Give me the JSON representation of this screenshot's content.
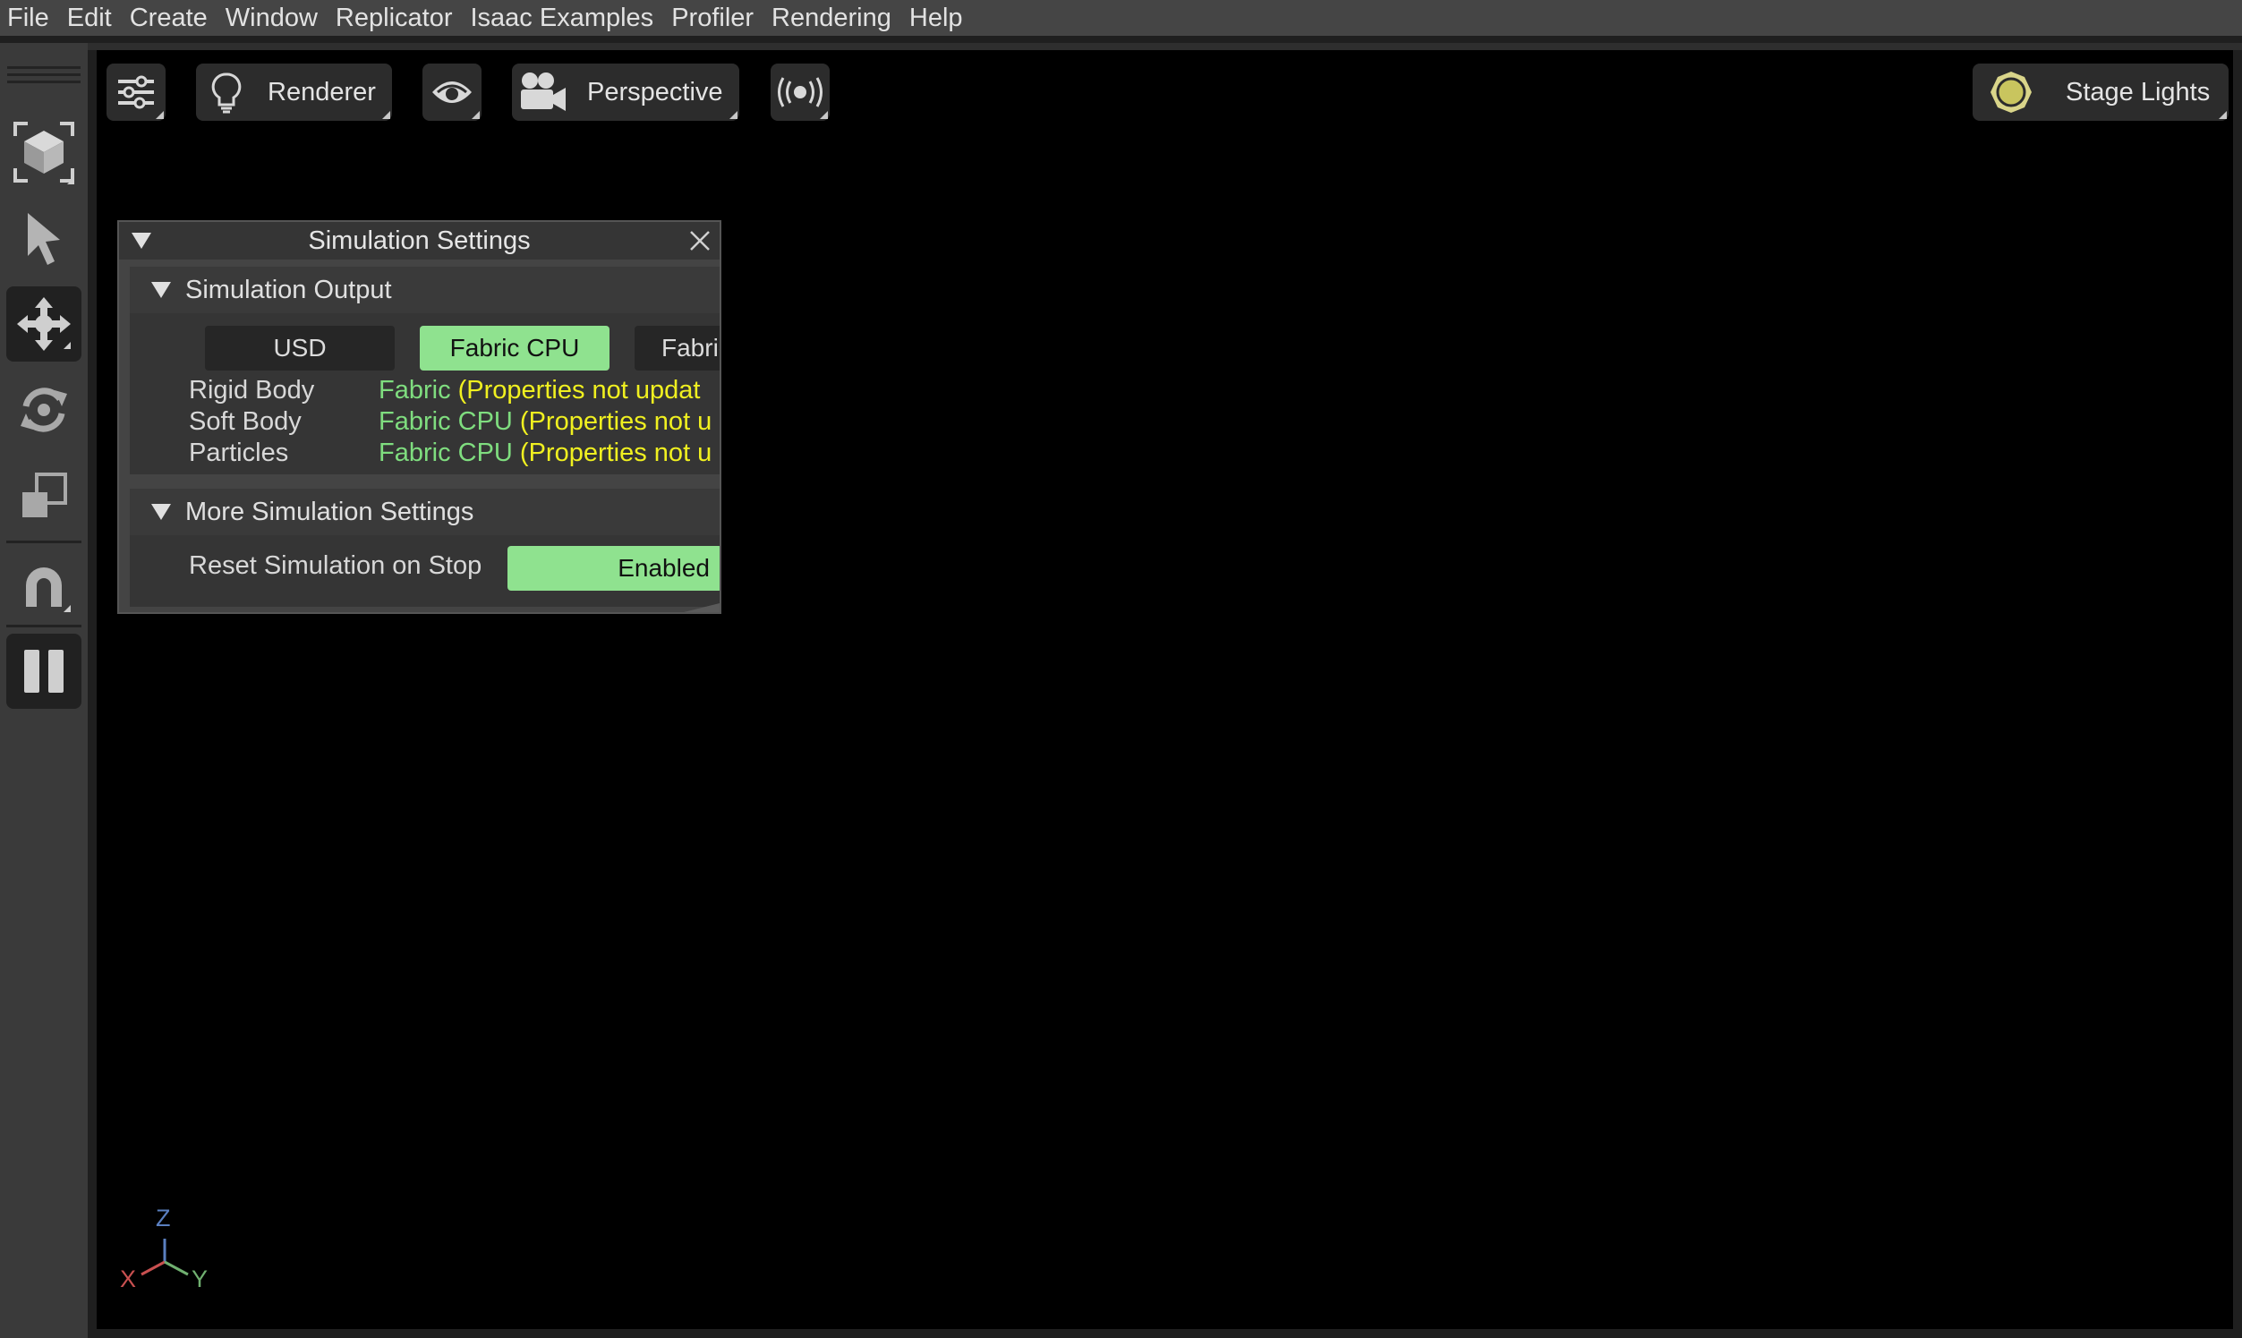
{
  "menu": {
    "items": [
      "File",
      "Edit",
      "Create",
      "Window",
      "Replicator",
      "Isaac Examples",
      "Profiler",
      "Rendering",
      "Help"
    ]
  },
  "left_toolbar": {
    "tools": [
      {
        "name": "frame-selection",
        "icon": "cube-frame-icon",
        "active": false
      },
      {
        "name": "select",
        "icon": "arrow-pointer-icon",
        "active": false
      },
      {
        "name": "move",
        "icon": "move-arrows-icon",
        "active": true
      },
      {
        "name": "rotate",
        "icon": "rotate-icon",
        "active": false
      },
      {
        "name": "scale",
        "icon": "scale-icon",
        "active": false
      },
      {
        "name": "snap",
        "icon": "magnet-icon",
        "active": false
      },
      {
        "name": "pause",
        "icon": "pause-icon",
        "active": true
      }
    ]
  },
  "viewport_toolbar": {
    "settings_icon": "sliders-icon",
    "renderer_label": "Renderer",
    "renderer_icon": "lightbulb-icon",
    "visibility_icon": "eye-icon",
    "camera_label": "Perspective",
    "camera_icon": "movie-camera-icon",
    "broadcast_icon": "broadcast-icon",
    "lights_label": "Stage Lights",
    "lights_icon": "sun-icon"
  },
  "sim_settings": {
    "title": "Simulation Settings",
    "output_section": {
      "title": "Simulation Output",
      "modes": [
        {
          "label": "USD",
          "selected": false
        },
        {
          "label": "Fabric CPU",
          "selected": true
        },
        {
          "label": "Fabric",
          "selected": false
        }
      ],
      "rows": [
        {
          "label": "Rigid Body",
          "value": "Fabric",
          "note": "(Properties not updat"
        },
        {
          "label": "Soft Body",
          "value": "Fabric CPU",
          "note": "(Properties not u"
        },
        {
          "label": "Particles",
          "value": "Fabric CPU",
          "note": "(Properties not u"
        }
      ]
    },
    "more_section": {
      "title": "More Simulation Settings",
      "reset_label": "Reset Simulation on Stop",
      "reset_value": "Enabled"
    }
  },
  "axis": {
    "x": "X",
    "y": "Y",
    "z": "Z"
  },
  "colors": {
    "accent_green": "#8fe28f",
    "value_green": "#7fdd7f",
    "warning_yellow": "#f0f020",
    "axis_x": "#c85050",
    "axis_y": "#70b070",
    "axis_z": "#5a7fc0"
  }
}
